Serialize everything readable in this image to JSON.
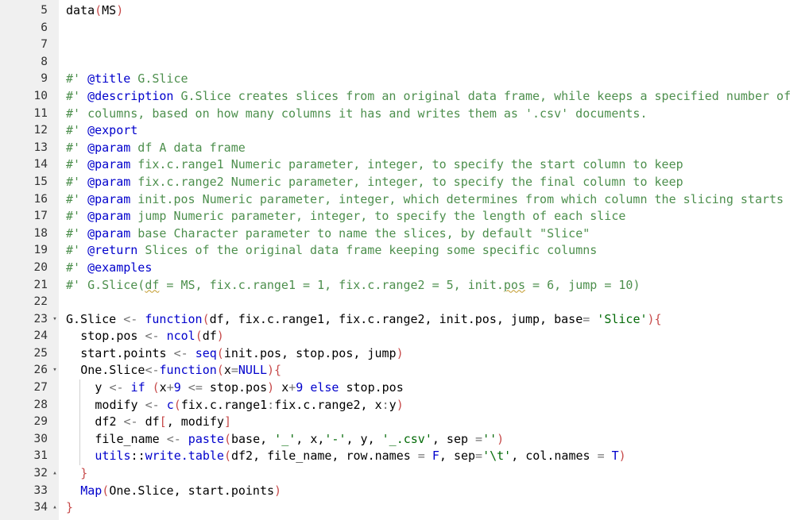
{
  "editor": {
    "lines": [
      {
        "n": "5",
        "fold": "",
        "indent": 0,
        "tokens": [
          {
            "t": "data",
            "c": "plain"
          },
          {
            "t": "(",
            "c": "paren"
          },
          {
            "t": "MS",
            "c": "plain"
          },
          {
            "t": ")",
            "c": "paren"
          }
        ]
      },
      {
        "n": "6",
        "fold": "",
        "indent": 0,
        "tokens": []
      },
      {
        "n": "7",
        "fold": "",
        "indent": 0,
        "tokens": []
      },
      {
        "n": "8",
        "fold": "",
        "indent": 0,
        "tokens": []
      },
      {
        "n": "9",
        "fold": "",
        "indent": 0,
        "tokens": [
          {
            "t": "#' ",
            "c": "comment"
          },
          {
            "t": "@title",
            "c": "roxy"
          },
          {
            "t": " G.Slice",
            "c": "comment"
          }
        ]
      },
      {
        "n": "10",
        "fold": "",
        "indent": 0,
        "tokens": [
          {
            "t": "#' ",
            "c": "comment"
          },
          {
            "t": "@description",
            "c": "roxy"
          },
          {
            "t": " G.Slice creates slices from an original data frame, while keeps a specified number of",
            "c": "comment"
          }
        ]
      },
      {
        "n": "11",
        "fold": "",
        "indent": 0,
        "tokens": [
          {
            "t": "#' columns, based on how many columns it has and writes them as '.csv' documents.",
            "c": "comment"
          }
        ]
      },
      {
        "n": "12",
        "fold": "",
        "indent": 0,
        "tokens": [
          {
            "t": "#' ",
            "c": "comment"
          },
          {
            "t": "@export",
            "c": "roxy"
          }
        ]
      },
      {
        "n": "13",
        "fold": "",
        "indent": 0,
        "tokens": [
          {
            "t": "#' ",
            "c": "comment"
          },
          {
            "t": "@param",
            "c": "roxy"
          },
          {
            "t": " df A data frame",
            "c": "comment"
          }
        ]
      },
      {
        "n": "14",
        "fold": "",
        "indent": 0,
        "tokens": [
          {
            "t": "#' ",
            "c": "comment"
          },
          {
            "t": "@param",
            "c": "roxy"
          },
          {
            "t": " fix.c.range1 Numeric parameter, integer, to specify the start column to keep",
            "c": "comment"
          }
        ]
      },
      {
        "n": "15",
        "fold": "",
        "indent": 0,
        "tokens": [
          {
            "t": "#' ",
            "c": "comment"
          },
          {
            "t": "@param",
            "c": "roxy"
          },
          {
            "t": " fix.c.range2 Numeric parameter, integer, to specify the final column to keep",
            "c": "comment"
          }
        ]
      },
      {
        "n": "16",
        "fold": "",
        "indent": 0,
        "tokens": [
          {
            "t": "#' ",
            "c": "comment"
          },
          {
            "t": "@param",
            "c": "roxy"
          },
          {
            "t": " init.pos Numeric parameter, integer, which determines from which column the slicing starts",
            "c": "comment"
          }
        ]
      },
      {
        "n": "17",
        "fold": "",
        "indent": 0,
        "tokens": [
          {
            "t": "#' ",
            "c": "comment"
          },
          {
            "t": "@param",
            "c": "roxy"
          },
          {
            "t": " jump Numeric parameter, integer, to specify the length of each slice",
            "c": "comment"
          }
        ]
      },
      {
        "n": "18",
        "fold": "",
        "indent": 0,
        "tokens": [
          {
            "t": "#' ",
            "c": "comment"
          },
          {
            "t": "@param",
            "c": "roxy"
          },
          {
            "t": " base Character parameter to name the slices, by default \"Slice\"",
            "c": "comment"
          }
        ]
      },
      {
        "n": "19",
        "fold": "",
        "indent": 0,
        "tokens": [
          {
            "t": "#' ",
            "c": "comment"
          },
          {
            "t": "@return",
            "c": "roxy"
          },
          {
            "t": " Slices of the original data frame keeping some specific columns",
            "c": "comment"
          }
        ]
      },
      {
        "n": "20",
        "fold": "",
        "indent": 0,
        "tokens": [
          {
            "t": "#' ",
            "c": "comment"
          },
          {
            "t": "@examples",
            "c": "roxy"
          }
        ]
      },
      {
        "n": "21",
        "fold": "",
        "indent": 0,
        "tokens": [
          {
            "t": "#' G.Slice(",
            "c": "comment"
          },
          {
            "t": "df",
            "c": "comment",
            "squig": true
          },
          {
            "t": " = MS, fix.c.range1 = 1, fix.c.range2 = 5, init.",
            "c": "comment"
          },
          {
            "t": "pos",
            "c": "comment",
            "squig": true
          },
          {
            "t": " = 6, jump = 10)",
            "c": "comment"
          }
        ]
      },
      {
        "n": "22",
        "fold": "",
        "indent": 0,
        "tokens": []
      },
      {
        "n": "23",
        "fold": "open",
        "indent": 0,
        "tokens": [
          {
            "t": "G.Slice ",
            "c": "plain"
          },
          {
            "t": "<-",
            "c": "op"
          },
          {
            "t": " ",
            "c": "plain"
          },
          {
            "t": "function",
            "c": "kw"
          },
          {
            "t": "(",
            "c": "paren"
          },
          {
            "t": "df, fix.c.range1, fix.c.range2, init.pos, jump, base",
            "c": "plain"
          },
          {
            "t": "=",
            "c": "op"
          },
          {
            "t": " ",
            "c": "plain"
          },
          {
            "t": "'Slice'",
            "c": "str"
          },
          {
            "t": "){",
            "c": "paren"
          }
        ]
      },
      {
        "n": "24",
        "fold": "",
        "indent": 1,
        "tokens": [
          {
            "t": "stop.pos ",
            "c": "plain"
          },
          {
            "t": "<-",
            "c": "op"
          },
          {
            "t": " ",
            "c": "plain"
          },
          {
            "t": "ncol",
            "c": "kw"
          },
          {
            "t": "(",
            "c": "paren"
          },
          {
            "t": "df",
            "c": "plain"
          },
          {
            "t": ")",
            "c": "paren"
          }
        ]
      },
      {
        "n": "25",
        "fold": "",
        "indent": 1,
        "tokens": [
          {
            "t": "start.points ",
            "c": "plain"
          },
          {
            "t": "<-",
            "c": "op"
          },
          {
            "t": " ",
            "c": "plain"
          },
          {
            "t": "seq",
            "c": "kw"
          },
          {
            "t": "(",
            "c": "paren"
          },
          {
            "t": "init.pos, stop.pos, jump",
            "c": "plain"
          },
          {
            "t": ")",
            "c": "paren"
          }
        ]
      },
      {
        "n": "26",
        "fold": "open",
        "indent": 1,
        "tokens": [
          {
            "t": "One.Slice",
            "c": "plain"
          },
          {
            "t": "<-",
            "c": "op"
          },
          {
            "t": "function",
            "c": "kw"
          },
          {
            "t": "(",
            "c": "paren"
          },
          {
            "t": "x",
            "c": "plain"
          },
          {
            "t": "=",
            "c": "op"
          },
          {
            "t": "NULL",
            "c": "num"
          },
          {
            "t": "){",
            "c": "paren"
          }
        ]
      },
      {
        "n": "27",
        "fold": "",
        "indent": 2,
        "tokens": [
          {
            "t": "y ",
            "c": "plain"
          },
          {
            "t": "<-",
            "c": "op"
          },
          {
            "t": " ",
            "c": "plain"
          },
          {
            "t": "if",
            "c": "kw"
          },
          {
            "t": " ",
            "c": "plain"
          },
          {
            "t": "(",
            "c": "paren"
          },
          {
            "t": "x",
            "c": "plain"
          },
          {
            "t": "+",
            "c": "op"
          },
          {
            "t": "9",
            "c": "num"
          },
          {
            "t": " ",
            "c": "plain"
          },
          {
            "t": "<=",
            "c": "op"
          },
          {
            "t": " stop.pos",
            "c": "plain"
          },
          {
            "t": ")",
            "c": "paren"
          },
          {
            "t": " x",
            "c": "plain"
          },
          {
            "t": "+",
            "c": "op"
          },
          {
            "t": "9",
            "c": "num"
          },
          {
            "t": " ",
            "c": "plain"
          },
          {
            "t": "else",
            "c": "kw"
          },
          {
            "t": " stop.pos",
            "c": "plain"
          }
        ]
      },
      {
        "n": "28",
        "fold": "",
        "indent": 2,
        "tokens": [
          {
            "t": "modify ",
            "c": "plain"
          },
          {
            "t": "<-",
            "c": "op"
          },
          {
            "t": " ",
            "c": "plain"
          },
          {
            "t": "c",
            "c": "kw"
          },
          {
            "t": "(",
            "c": "paren"
          },
          {
            "t": "fix.c.range1",
            "c": "plain"
          },
          {
            "t": ":",
            "c": "op"
          },
          {
            "t": "fix.c.range2, x",
            "c": "plain"
          },
          {
            "t": ":",
            "c": "op"
          },
          {
            "t": "y",
            "c": "plain"
          },
          {
            "t": ")",
            "c": "paren"
          }
        ]
      },
      {
        "n": "29",
        "fold": "",
        "indent": 2,
        "tokens": [
          {
            "t": "df2 ",
            "c": "plain"
          },
          {
            "t": "<-",
            "c": "op"
          },
          {
            "t": " df",
            "c": "plain"
          },
          {
            "t": "[",
            "c": "paren"
          },
          {
            "t": ", modify",
            "c": "plain"
          },
          {
            "t": "]",
            "c": "paren"
          }
        ]
      },
      {
        "n": "30",
        "fold": "",
        "indent": 2,
        "tokens": [
          {
            "t": "file_name ",
            "c": "plain"
          },
          {
            "t": "<-",
            "c": "op"
          },
          {
            "t": " ",
            "c": "plain"
          },
          {
            "t": "paste",
            "c": "kw"
          },
          {
            "t": "(",
            "c": "paren"
          },
          {
            "t": "base, ",
            "c": "plain"
          },
          {
            "t": "'_'",
            "c": "str"
          },
          {
            "t": ", x,",
            "c": "plain"
          },
          {
            "t": "'-'",
            "c": "str"
          },
          {
            "t": ", y, ",
            "c": "plain"
          },
          {
            "t": "'_.csv'",
            "c": "str"
          },
          {
            "t": ", sep ",
            "c": "plain"
          },
          {
            "t": "=",
            "c": "op"
          },
          {
            "t": "''",
            "c": "str"
          },
          {
            "t": ")",
            "c": "paren"
          }
        ]
      },
      {
        "n": "31",
        "fold": "",
        "indent": 2,
        "tokens": [
          {
            "t": "utils",
            "c": "kw"
          },
          {
            "t": "::",
            "c": "plain"
          },
          {
            "t": "write.table",
            "c": "kw"
          },
          {
            "t": "(",
            "c": "paren"
          },
          {
            "t": "df2, file_name, row.names ",
            "c": "plain"
          },
          {
            "t": "=",
            "c": "op"
          },
          {
            "t": " ",
            "c": "plain"
          },
          {
            "t": "F",
            "c": "num"
          },
          {
            "t": ", sep",
            "c": "plain"
          },
          {
            "t": "=",
            "c": "op"
          },
          {
            "t": "'\\t'",
            "c": "str"
          },
          {
            "t": ", col.names ",
            "c": "plain"
          },
          {
            "t": "=",
            "c": "op"
          },
          {
            "t": " ",
            "c": "plain"
          },
          {
            "t": "T",
            "c": "num"
          },
          {
            "t": ")",
            "c": "paren"
          }
        ]
      },
      {
        "n": "32",
        "fold": "close",
        "indent": 1,
        "tokens": [
          {
            "t": "}",
            "c": "paren"
          }
        ]
      },
      {
        "n": "33",
        "fold": "",
        "indent": 1,
        "tokens": [
          {
            "t": "Map",
            "c": "kw"
          },
          {
            "t": "(",
            "c": "paren"
          },
          {
            "t": "One.Slice, start.points",
            "c": "plain"
          },
          {
            "t": ")",
            "c": "paren"
          }
        ]
      },
      {
        "n": "34",
        "fold": "close",
        "indent": 0,
        "tokens": [
          {
            "t": "}",
            "c": "paren"
          }
        ]
      }
    ],
    "icons": {
      "fold_open": "▾",
      "fold_close": "▴"
    }
  }
}
